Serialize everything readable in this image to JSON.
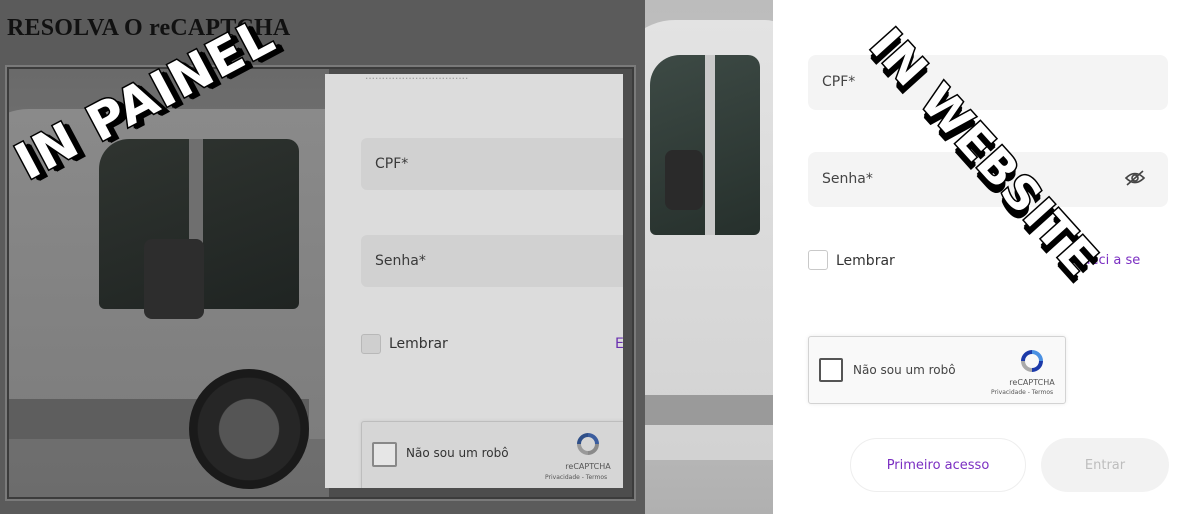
{
  "painel": {
    "title": "RESOLVA O reCAPTCHA",
    "cut_text": "...............................",
    "form": {
      "cpf_label": "CPF*",
      "senha_label": "Senha*",
      "lembrar_label": "Lembrar",
      "forgot_label": "E",
      "recaptcha": {
        "label": "Não sou um robô",
        "brand": "reCAPTCHA",
        "links": "Privacidade - Termos"
      }
    },
    "sticker": "IN PAINEL"
  },
  "website": {
    "form": {
      "cpf_label": "CPF*",
      "senha_label": "Senha*",
      "lembrar_label": "Lembrar",
      "forgot_label": "Esqueci a se",
      "recaptcha": {
        "label": "Não sou um robô",
        "brand": "reCAPTCHA",
        "links": "Privacidade - Termos"
      },
      "primeiro_acesso_label": "Primeiro acesso",
      "entrar_label": "Entrar"
    },
    "sticker": "IN WEBSITE"
  },
  "colors": {
    "accent": "#7b2fc2",
    "disabled_text": "#bdbdbd",
    "field_bg": "#f4f4f4"
  },
  "icons": [
    "recaptcha-logo-icon",
    "eye-slash-icon"
  ]
}
